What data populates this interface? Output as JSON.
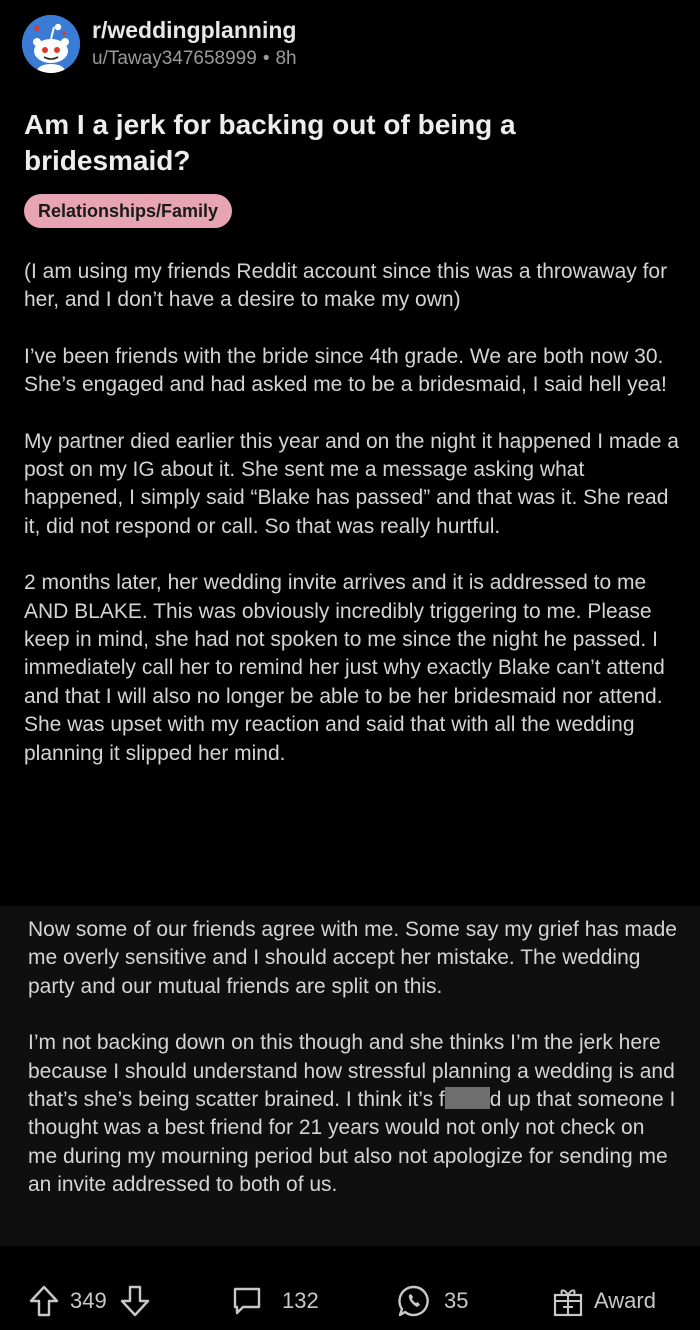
{
  "post": {
    "subreddit": "r/weddingplanning",
    "author": "u/Taway347658999",
    "separator": "•",
    "age": "8h",
    "title": "Am I a jerk for backing out of being a bridesmaid?",
    "flair": "Relationships/Family",
    "paragraphs": [
      "(I am using my friends Reddit account since this was a throwaway for her, and I don’t have a desire to make my own)",
      "I’ve been friends with the bride since 4th grade. We are both now 30. She’s engaged and had asked me to be a bridesmaid, I said hell yea!",
      "My partner died earlier this year and on the night it happened I made a post on my IG about it. She sent me a message asking what happened, I simply said “Blake has passed” and that was it. She read it, did not respond or call. So that was really hurtful.",
      "2 months later, her wedding invite arrives and it is addressed to me AND BLAKE. This was obviously incredibly triggering to me. Please keep in mind, she had not spoken to me since the night he passed. I immediately call her to remind her just why exactly Blake can’t attend and that I will also no longer be able to be her bridesmaid nor attend. She was upset with my reaction and said that with all the wedding planning it slipped her mind.",
      "Now some of our friends agree with me. Some say my grief has made me overly sensitive and I should accept her mistake. The wedding party and our mutual friends are split on this."
    ],
    "last_paragraph": {
      "before": "I’m not backing down on this though and she thinks I’m the jerk here because I should understand how stressful planning a wedding is and that’s she’s being scatter brained. I think it’s f",
      "after": "d up that someone I thought was a best friend for 21 years would not only not check on me during my mourning period but also not apologize for sending me an invite addressed to both of us."
    }
  },
  "actions": {
    "upvote_icon": "arrow-up-icon",
    "score": "349",
    "downvote_icon": "arrow-down-icon",
    "comment_icon": "comment-icon",
    "comments": "132",
    "share_icon": "whatsapp-icon",
    "shares": "35",
    "award_icon": "gift-icon",
    "award_label": "Award"
  },
  "colors": {
    "background": "#000000",
    "flair_bg": "#e7a5b3",
    "avatar_bg": "#3a7bd5",
    "text": "#d4d4d4",
    "muted": "#9a9a9a"
  }
}
